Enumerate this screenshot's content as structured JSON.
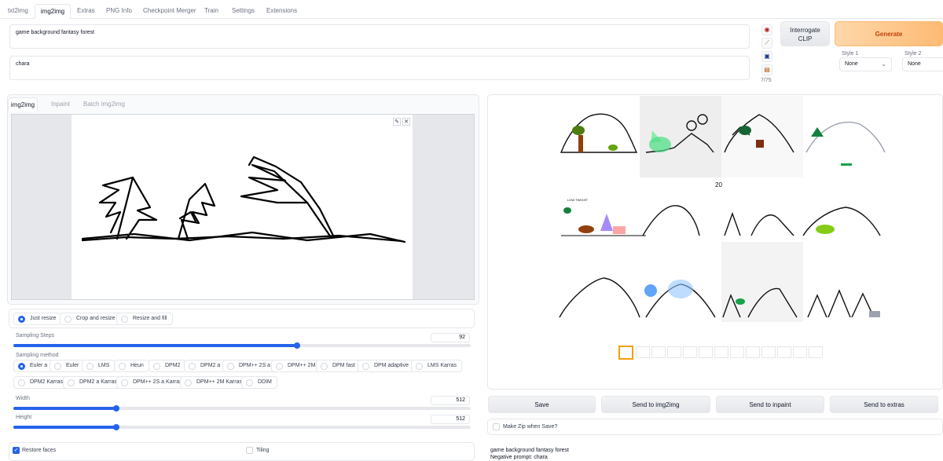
{
  "top_tabs": [
    "txt2img",
    "img2img",
    "Extras",
    "PNG Info",
    "Checkpoint Merger",
    "Train",
    "Settings",
    "Extensions"
  ],
  "active_top_tab": "img2img",
  "prompt": "game background fantasy forest",
  "negative_prompt": "chara",
  "token_count": "7/75",
  "interrogate_label": "Interrogate\nCLIP",
  "generate_label": "Generate",
  "style1": {
    "label": "Style 1",
    "value": "None"
  },
  "style2": {
    "label": "Style 2",
    "value": "None"
  },
  "subtabs": [
    "img2img",
    "Inpaint",
    "Batch img2img"
  ],
  "resize_modes": [
    "Just resize",
    "Crop and resize",
    "Resize and fill"
  ],
  "sampling_steps": {
    "label": "Sampling Steps",
    "value": "92",
    "fraction": 0.62
  },
  "sampling_method": {
    "label": "Sampling method",
    "options": [
      "Euler a",
      "Euler",
      "LMS",
      "Heun",
      "DPM2",
      "DPM2 a",
      "DPM++ 2S a",
      "DPM++ 2M",
      "DPM fast",
      "DPM adaptive",
      "LMS Karras",
      "DPM2 Karras",
      "DPM2 a Karras",
      "DPM++ 2S a Karras",
      "DPM++ 2M Karras",
      "DDIM"
    ],
    "selected": "Euler a"
  },
  "width": {
    "label": "Width",
    "value": "512",
    "fraction": 0.225
  },
  "height": {
    "label": "Height",
    "value": "512",
    "fraction": 0.225
  },
  "restore_faces": {
    "label": "Restore faces",
    "checked": true
  },
  "tiling": {
    "label": "Tiling",
    "checked": false
  },
  "grid_overlay_text": "20",
  "grid_caption": "LOW TWIGHT",
  "actions": [
    "Save",
    "Send to img2img",
    "Send to inpaint",
    "Send to extras"
  ],
  "make_zip": "Make Zip when Save?",
  "output_info_line1": "game background fantasy forest",
  "output_info_line2": "Negative prompt: chara",
  "colors": {
    "accent": "#2563eb",
    "generate": "#fdba74",
    "selected_thumb": "#f59e0b"
  },
  "icons": [
    "paint-icon",
    "brush-icon",
    "save-icon",
    "clipboard-icon",
    "edit-icon",
    "close-icon"
  ]
}
